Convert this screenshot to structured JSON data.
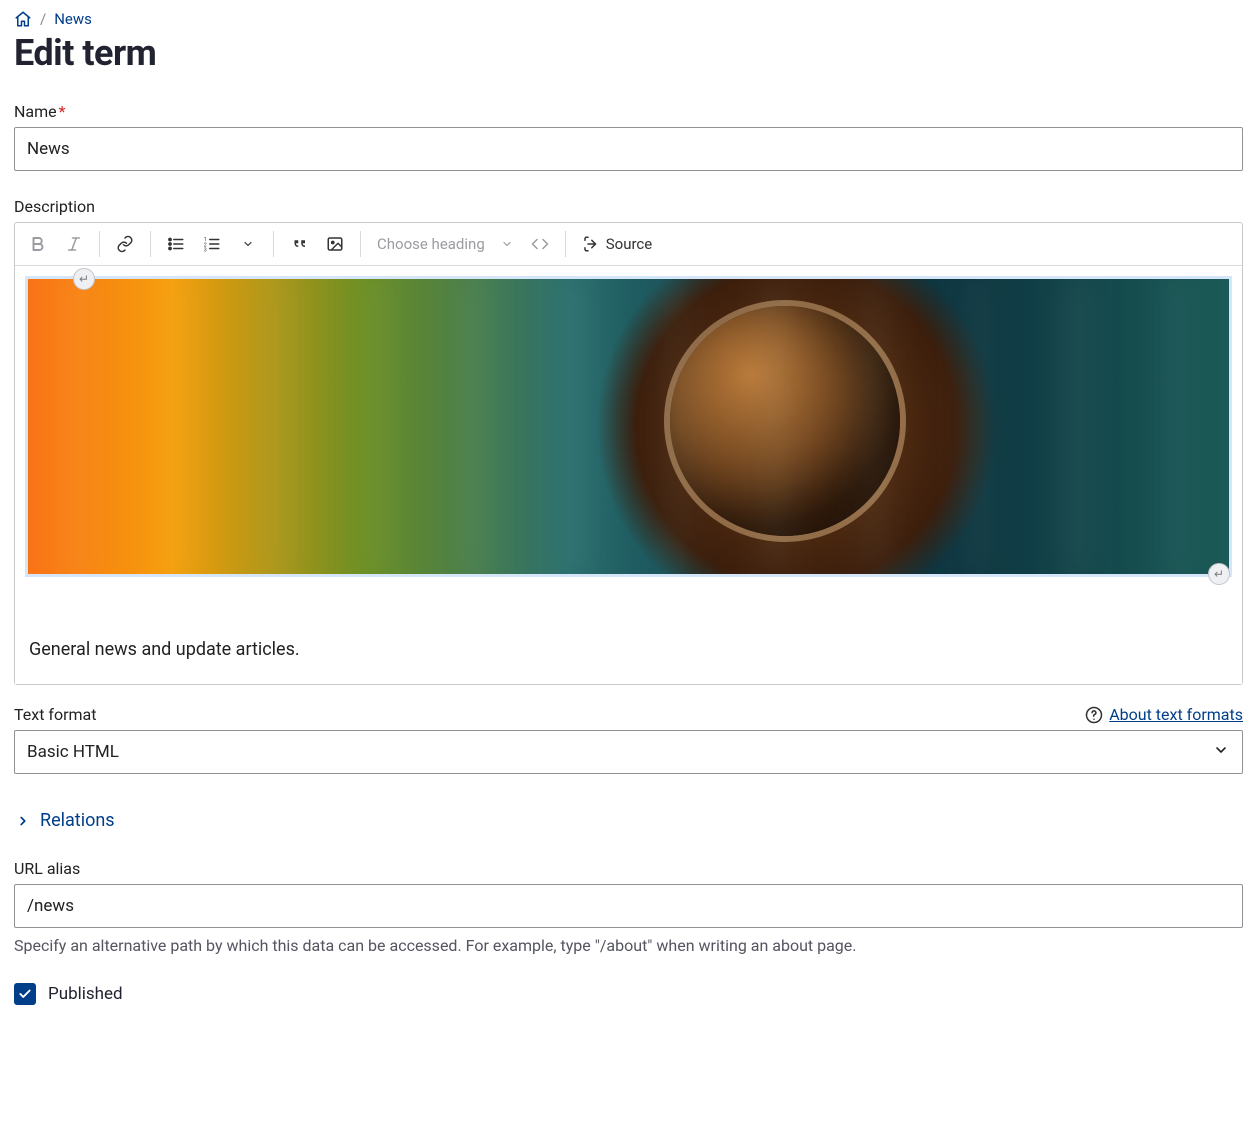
{
  "breadcrumb": {
    "current": "News"
  },
  "page": {
    "title": "Edit term"
  },
  "fields": {
    "name": {
      "label": "Name",
      "required_mark": "*",
      "value": "News"
    },
    "description": {
      "label": "Description",
      "body_text": "General news and update articles."
    },
    "text_format": {
      "label": "Text format",
      "about_link": "About text formats",
      "selected": "Basic HTML",
      "options": [
        "Basic HTML"
      ]
    },
    "relations": {
      "summary": "Relations"
    },
    "url_alias": {
      "label": "URL alias",
      "value": "/news",
      "help": "Specify an alternative path by which this data can be accessed. For example, type \"/about\" when writing an about page."
    },
    "published": {
      "label": "Published",
      "checked": true
    }
  },
  "editor_toolbar": {
    "heading_placeholder": "Choose heading",
    "source_label": "Source",
    "icons": {
      "bold": "bold-icon",
      "italic": "italic-icon",
      "link": "link-icon",
      "ul": "bulleted-list-icon",
      "ol": "numbered-list-icon",
      "indent_dd": "indent-dropdown-icon",
      "quote": "blockquote-icon",
      "image": "image-icon",
      "heading_dd": "heading-dropdown-icon",
      "code": "code-icon",
      "show_more": "show-more-icon"
    }
  }
}
